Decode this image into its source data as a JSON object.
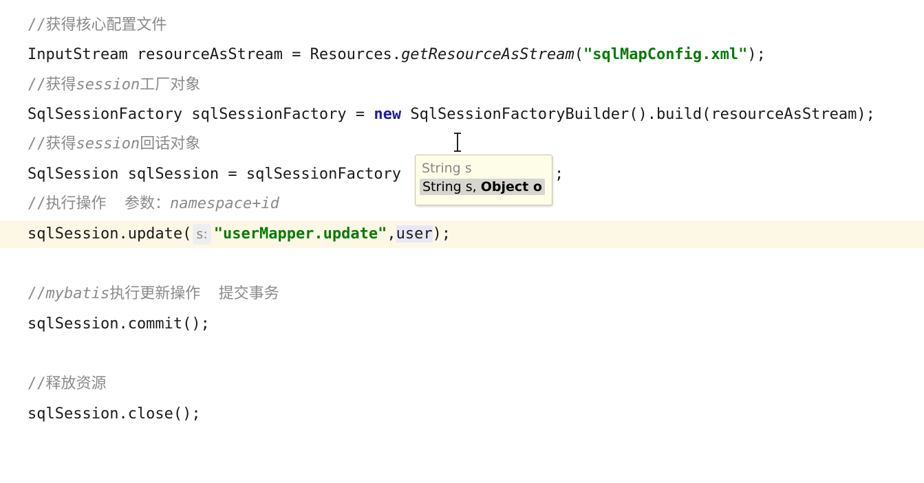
{
  "editor": {
    "lines": {
      "l1": {
        "comment": "//获得核心配置文件"
      },
      "l2": {
        "a": "InputStream resourceAsStream = Resources.",
        "method": "getResourceAsStream",
        "b": "(",
        "str": "\"sqlMapConfig.xml\"",
        "c": ");"
      },
      "l3": {
        "comment_prefix": "//获得",
        "comment_italic": "session",
        "comment_suffix": "工厂对象"
      },
      "l4": {
        "a": "SqlSessionFactory sqlSessionFactory = ",
        "kw": "new",
        "b": " SqlSessionFactoryBuilder().build(resourceAsStream);"
      },
      "l5": {
        "comment_prefix": "//获得",
        "comment_italic": "session",
        "comment_suffix": "回话对象"
      },
      "l6": {
        "a": "SqlSession sqlSession = sqlSessionFactory",
        "b": ";"
      },
      "l7": {
        "comment_prefix": "//执行操作  参数：",
        "comment_italic": "namespace+id"
      },
      "l8": {
        "a": "sqlSession.update(",
        "hint": "s:",
        "str": "\"userMapper.update\"",
        "b": ",",
        "sel": "user",
        "c": ");"
      },
      "l10": {
        "comment_prefix": "//",
        "comment_italic": "mybatis",
        "comment_suffix": "执行更新操作  提交事务"
      },
      "l11": {
        "a": "sqlSession.commit();"
      },
      "l13": {
        "comment": "//释放资源"
      },
      "l14": {
        "a": "sqlSession.close();"
      }
    },
    "popup": {
      "option1": "String s",
      "option2_plain": "String s, ",
      "option2_bold": "Object o"
    }
  }
}
